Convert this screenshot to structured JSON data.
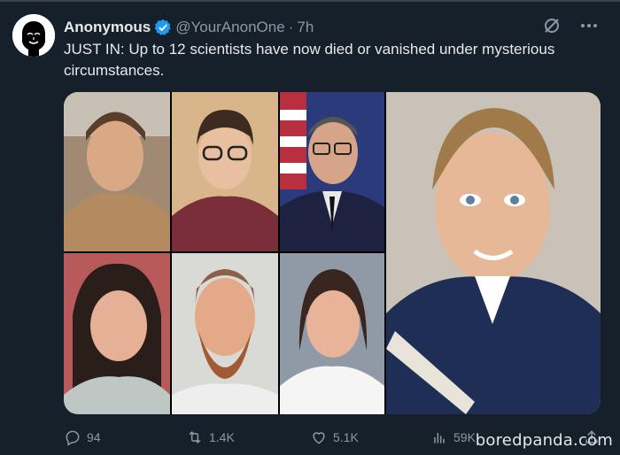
{
  "tweet": {
    "author_name": "Anonymous",
    "handle": "@YourAnonOne",
    "separator": "·",
    "time": "7h",
    "text": "JUST IN: Up to 12 scientists have now died or vanished under mysterious circumstances."
  },
  "icons": {
    "avatar": "anonymous-mask-avatar",
    "verified": "verified-badge-icon",
    "grok": "grok-icon",
    "more": "more-icon",
    "reply": "reply-icon",
    "retweet": "retweet-icon",
    "like": "like-icon",
    "views": "views-icon",
    "share": "share-icon"
  },
  "actions": {
    "replies": "94",
    "retweets": "1.4K",
    "likes": "5.1K",
    "views": "59K"
  },
  "watermark": "boredpanda.com",
  "colors": {
    "background": "#15202b",
    "text": "#e7e9ea",
    "muted": "#8b98a5",
    "verified": "#1d9bf0"
  }
}
